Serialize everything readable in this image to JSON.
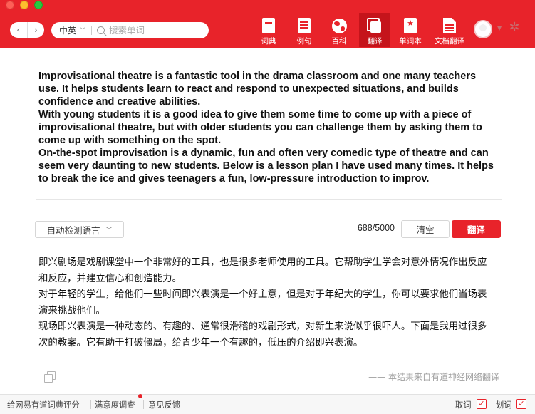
{
  "header": {
    "back_glyph": "‹",
    "forward_glyph": "›",
    "language_select": "中英",
    "search_placeholder": "搜索单词",
    "tabs": [
      {
        "label": "词典",
        "icon": "book-icon"
      },
      {
        "label": "例句",
        "icon": "list-icon"
      },
      {
        "label": "百科",
        "icon": "globe-icon"
      },
      {
        "label": "翻译",
        "icon": "cards-icon",
        "active": true
      },
      {
        "label": "单词本",
        "icon": "bookmark-icon"
      },
      {
        "label": "文档翻译",
        "icon": "document-icon"
      }
    ],
    "settings_glyph": "✲"
  },
  "source": {
    "paragraphs": [
      "Improvisational theatre is a fantastic tool in the drama classroom and one many teachers use. It helps students learn to react and respond to unexpected situations, and builds confidence and creative abilities.",
      "With young students it is a good idea to give them some time to come up with a piece of improvisational theatre, but with older students you can challenge them by asking them to come up with something on the spot.",
      "On-the-spot improvisation is a dynamic, fun and often very comedic type of theatre and can seem very daunting to new students. Below is a lesson plan I have used many times. It helps to break the ice and gives teenagers a fun, low-pressure introduction to improv."
    ]
  },
  "controls": {
    "detect_language": "自动检测语言",
    "char_count": "688/5000",
    "clear_label": "清空",
    "translate_label": "翻译"
  },
  "result": {
    "paragraphs": [
      "即兴剧场是戏剧课堂中一个非常好的工具，也是很多老师使用的工具。它帮助学生学会对意外情况作出反应和反应，并建立信心和创造能力。",
      "对于年轻的学生，给他们一些时间即兴表演是一个好主意，但是对于年纪大的学生，你可以要求他们当场表演来挑战他们。",
      "现场即兴表演是一种动态的、有趣的、通常很滑稽的戏剧形式，对新生来说似乎很吓人。下面是我用过很多次的教案。它有助于打破僵局，给青少年一个有趣的，低压的介绍即兴表演。"
    ],
    "source_note": "—— 本结果来自有道神经网络翻译"
  },
  "footer": {
    "rate": "给网易有道词典评分",
    "survey": "满意度调查",
    "feedback": "意见反馈",
    "pick_word": "取词",
    "select_word": "划词",
    "check_glyph": "✓"
  },
  "colors": {
    "accent": "#e8232a",
    "accent_dark": "#c5141b"
  }
}
